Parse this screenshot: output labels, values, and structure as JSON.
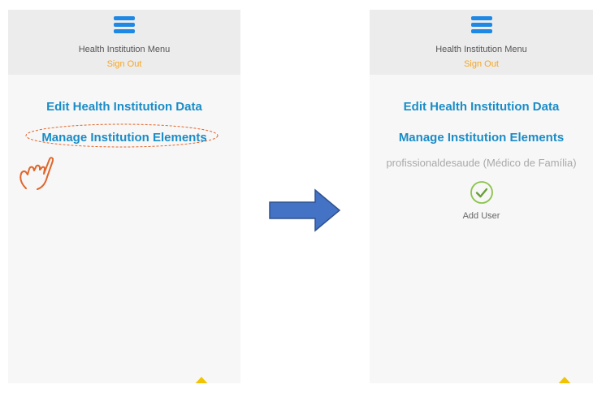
{
  "before_screen": {
    "header": {
      "title": "Health Institution Menu",
      "sign_out": "Sign Out",
      "menu_icon": "hamburger-menu-icon"
    },
    "menu": {
      "edit_data": "Edit Health Institution Data",
      "manage_elements": "Manage Institution Elements"
    },
    "pointer_icon": "pointing-hand-icon",
    "fab_icon": "yellow-triangle-icon"
  },
  "after_screen": {
    "header": {
      "title": "Health Institution Menu",
      "sign_out": "Sign Out",
      "menu_icon": "hamburger-menu-icon"
    },
    "menu": {
      "edit_data": "Edit Health Institution Data",
      "manage_elements": "Manage Institution Elements"
    },
    "professional": "profissionaldesaude (Médico de Família)",
    "add_user": {
      "label": "Add User",
      "icon": "check-circle-icon"
    },
    "fab_icon": "yellow-triangle-icon"
  },
  "transition_icon": "right-arrow-icon",
  "colors": {
    "link_blue": "#1a8cc7",
    "menu_icon_blue": "#1e88e5",
    "sign_out_orange": "#f5a623",
    "hand_orange": "#e0662b",
    "check_green": "#8bc34a",
    "arrow_blue": "#4472c4",
    "fab_yellow": "#f2c300"
  }
}
